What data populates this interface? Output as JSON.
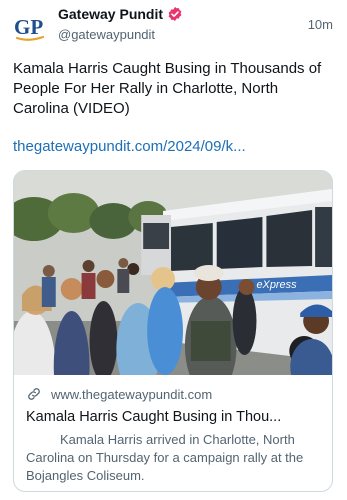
{
  "author": {
    "name": "Gateway Pundit",
    "handle": "@gatewaypundit",
    "avatar_text": "GP"
  },
  "post": {
    "timestamp": "10m",
    "text": "Kamala Harris Caught Busing in Thousands of People For Her Rally in Charlotte, North Carolina (VIDEO)",
    "link": "thegatewaypundit.com/2024/09/k..."
  },
  "card": {
    "domain": "www.thegatewaypundit.com",
    "title": "Kamala Harris Caught Busing in Thou...",
    "description": "Kamala Harris arrived in Charlotte, North Carolina on Thursday for a campaign rally at the Bojangles Coliseum.",
    "image_bus_sign": "eXpress"
  },
  "colors": {
    "verified_badge": "#e8336d",
    "link": "#1d6fb8",
    "avatar_blue": "#1f4e8c",
    "avatar_gold": "#e2a52b"
  }
}
